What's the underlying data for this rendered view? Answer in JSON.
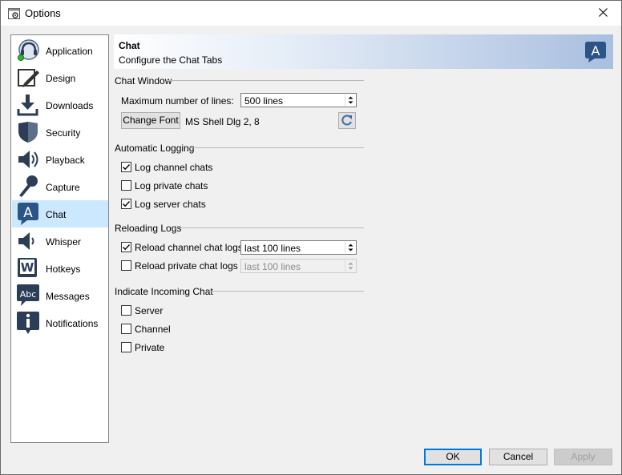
{
  "window": {
    "title": "Options",
    "title_icon": "settings-window-icon",
    "close_icon": "close-icon"
  },
  "sidebar": {
    "items": [
      {
        "label": "Application",
        "icon": "teamspeak-application-icon",
        "active": false
      },
      {
        "label": "Design",
        "icon": "pencil-design-icon",
        "active": false
      },
      {
        "label": "Downloads",
        "icon": "download-arrow-icon",
        "active": false
      },
      {
        "label": "Security",
        "icon": "shield-icon",
        "active": false
      },
      {
        "label": "Playback",
        "icon": "speaker-icon",
        "active": false
      },
      {
        "label": "Capture",
        "icon": "microphone-icon",
        "active": false
      },
      {
        "label": "Chat",
        "icon": "chat-bubble-icon",
        "active": true
      },
      {
        "label": "Whisper",
        "icon": "whisper-speaker-icon",
        "active": false
      },
      {
        "label": "Hotkeys",
        "icon": "keyboard-w-key-icon",
        "active": false
      },
      {
        "label": "Messages",
        "icon": "abc-message-icon",
        "active": false
      },
      {
        "label": "Notifications",
        "icon": "info-icon",
        "active": false
      }
    ],
    "active_color": "#cce8ff"
  },
  "header": {
    "title": "Chat",
    "subtitle": "Configure the Chat Tabs",
    "icon": "chat-bubble-icon"
  },
  "chat_window": {
    "group_title": "Chat Window",
    "max_lines_label": "Maximum number of lines:",
    "max_lines_value": "500 lines",
    "change_font_label": "Change Font",
    "font_value": "MS Shell Dlg 2, 8",
    "reset_icon": "refresh-icon"
  },
  "automatic_logging": {
    "group_title": "Automatic Logging",
    "log_channel": {
      "label": "Log channel chats",
      "checked": true
    },
    "log_private": {
      "label": "Log private chats",
      "checked": false
    },
    "log_server": {
      "label": "Log server chats",
      "checked": true
    }
  },
  "reloading_logs": {
    "group_title": "Reloading Logs",
    "reload_channel": {
      "label": "Reload channel chat logs",
      "checked": true,
      "value": "last 100 lines"
    },
    "reload_private": {
      "label": "Reload private chat logs",
      "checked": false,
      "value": "last 100 lines"
    }
  },
  "incoming_chat": {
    "group_title": "Indicate Incoming Chat",
    "server": {
      "label": "Server",
      "checked": false
    },
    "channel": {
      "label": "Channel",
      "checked": false
    },
    "private": {
      "label": "Private",
      "checked": false
    }
  },
  "footer": {
    "ok_label": "OK",
    "cancel_label": "Cancel",
    "apply_label": "Apply"
  },
  "colors": {
    "accent": "#0078d7",
    "header_gradient_end": "#a9bfe0"
  }
}
